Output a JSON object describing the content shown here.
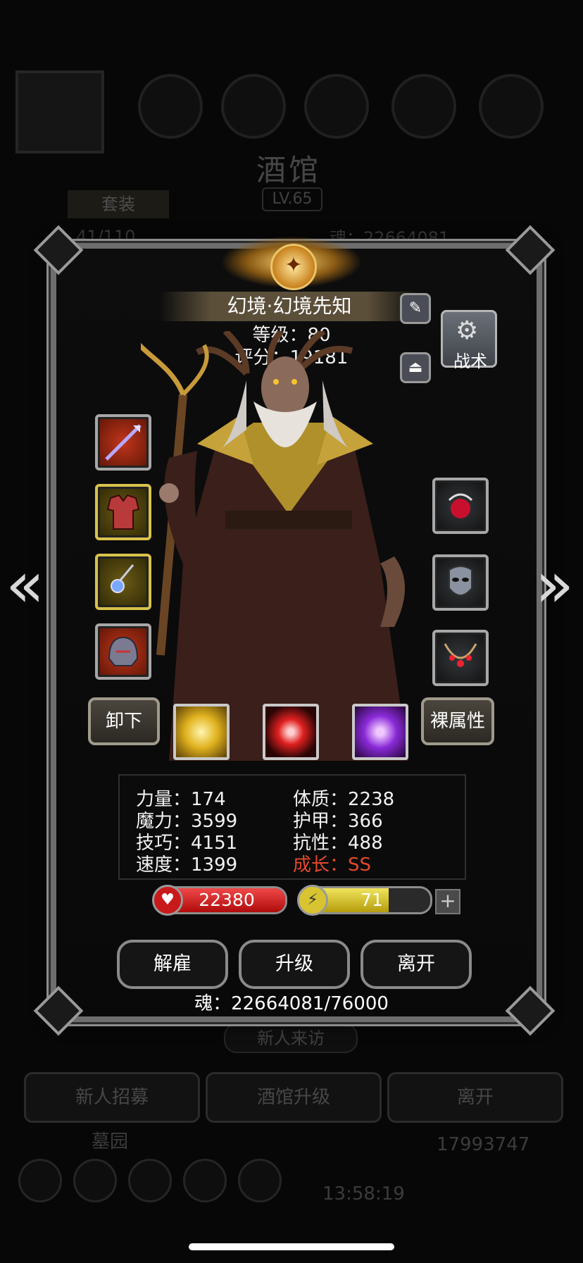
{
  "background": {
    "title": "酒馆",
    "level": "LV.65",
    "suit_tab": "套装",
    "count_text": "41/110",
    "soul_text": "魂：22664081",
    "new_visitor": "新人来访",
    "bottom_buttons": [
      "新人招募",
      "酒馆升级",
      "离开"
    ],
    "lower_label": "墓园",
    "gold": "17993747",
    "clock": "13:58:19"
  },
  "hero": {
    "name": "幻境·幻境先知",
    "level_text": "等级：80",
    "score_text": "评分：19181",
    "tactics_label": "战术"
  },
  "buttons": {
    "unequip": "卸下",
    "base_attrs": "裸属性",
    "dismiss": "解雇",
    "upgrade": "升级",
    "leave": "离开"
  },
  "stats": {
    "strength": "力量：174",
    "magic": "魔力：3599",
    "skill": "技巧：4151",
    "speed": "速度：1399",
    "constitution": "体质：2238",
    "armor": "护甲：366",
    "resistance": "抗性：488",
    "growth": "成长：SS"
  },
  "bars": {
    "hp": "22380",
    "energy": "71",
    "energy_fill_pct": 68
  },
  "soul_footer": "魂：22664081/76000",
  "colors": {
    "growth": "#e3492a",
    "hp": "#d71e1e",
    "energy": "#e6d640"
  }
}
